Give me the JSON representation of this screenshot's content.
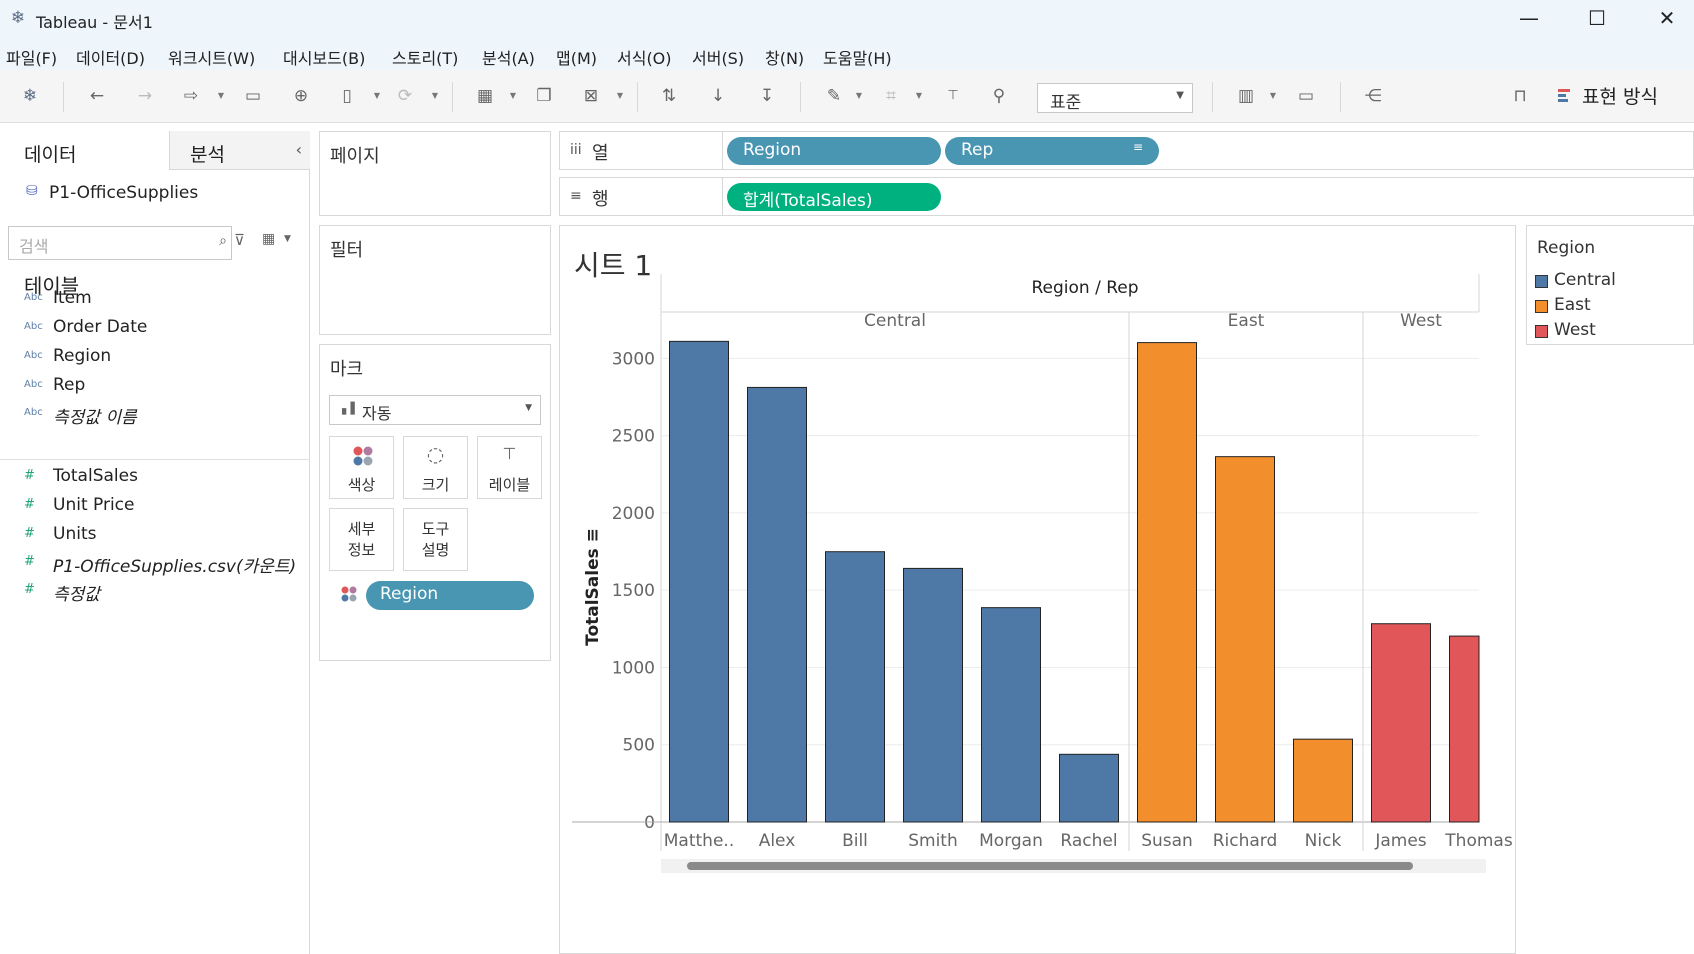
{
  "window": {
    "app_icon": "tableau-logo-icon",
    "title": "Tableau - 문서1",
    "minimize": "—",
    "maximize": "☐",
    "close": "✕"
  },
  "menu": [
    "파일(F)",
    "데이터(D)",
    "워크시트(W)",
    "대시보드(B)",
    "스토리(T)",
    "분석(A)",
    "맵(M)",
    "서식(O)",
    "서버(S)",
    "창(N)",
    "도움말(H)"
  ],
  "toolbar": {
    "fit_value": "표준",
    "show_me_label": "표현 방식",
    "icons": [
      "tableau-logo-icon",
      "undo-icon",
      "redo-icon",
      "replay-icon",
      "save-icon",
      "new-datasource-icon",
      "pause-updates-icon",
      "refresh-icon",
      "new-worksheet-icon",
      "duplicate-sheet-icon",
      "clear-sheet-icon",
      "swap-axes-icon",
      "sort-ascending-icon",
      "sort-descending-icon",
      "highlight-icon",
      "group-icon",
      "label-icon",
      "pin-icon",
      "cards-icon",
      "presentation-icon",
      "share-icon",
      "format-painter-icon",
      "show-me-icon"
    ]
  },
  "data_pane": {
    "tab_data": "데이터",
    "tab_analytics": "분석",
    "collapse_glyph": "‹",
    "datasource": "P1-OfficeSupplies",
    "search_placeholder": "검색",
    "tables_heading": "테이블",
    "dimension_icon": "Abc",
    "measure_icon": "#",
    "dimensions": [
      {
        "label": "Item",
        "italic": false
      },
      {
        "label": "Order Date",
        "italic": false
      },
      {
        "label": "Region",
        "italic": false
      },
      {
        "label": "Rep",
        "italic": false
      },
      {
        "label": "측정값 이름",
        "italic": true
      }
    ],
    "measures": [
      {
        "label": "TotalSales",
        "italic": false
      },
      {
        "label": "Unit Price",
        "italic": false
      },
      {
        "label": "Units",
        "italic": false
      },
      {
        "label": "P1-OfficeSupplies.csv(카운트)",
        "italic": true
      },
      {
        "label": "측정값",
        "italic": true
      }
    ]
  },
  "cards": {
    "pages": "페이지",
    "filters": "필터",
    "marks": "마크",
    "mark_type": "자동",
    "buttons": {
      "color": "색상",
      "size": "크기",
      "label": "레이블",
      "detail_1": "세부",
      "detail_2": "정보",
      "tooltip_1": "도구",
      "tooltip_2": "설명"
    },
    "marks_pill": "Region"
  },
  "shelves": {
    "columns_label": "열",
    "rows_label": "행",
    "columns_icon": "iii",
    "rows_icon": "≡",
    "columns_pills": [
      "Region",
      "Rep"
    ],
    "rows_pills": [
      "합계(TotalSales)"
    ]
  },
  "sheet_title": "시트 1",
  "legend": {
    "title": "Region",
    "items": [
      {
        "label": "Central",
        "color": "#4e79a7"
      },
      {
        "label": "East",
        "color": "#f28e2b"
      },
      {
        "label": "West",
        "color": "#e15759"
      }
    ]
  },
  "chart_data": {
    "type": "bar",
    "header_title": "Region / Rep",
    "ylabel": "TotalSales",
    "ylim": [
      0,
      3300
    ],
    "yticks": [
      0,
      500,
      1000,
      1500,
      2000,
      2500,
      3000
    ],
    "grid": true,
    "groups": [
      {
        "name": "Central",
        "color": "#4e79a7",
        "reps": [
          "Matthe..",
          "Alex",
          "Bill",
          "Smith",
          "Morgan",
          "Rachel"
        ],
        "values": [
          3110,
          2812,
          1749,
          1641,
          1387,
          438
        ]
      },
      {
        "name": "East",
        "color": "#f28e2b",
        "reps": [
          "Susan",
          "Richard",
          "Nick"
        ],
        "values": [
          3102,
          2364,
          536
        ]
      },
      {
        "name": "West",
        "color": "#e15759",
        "reps": [
          "James",
          "Thomas"
        ],
        "values": [
          1283,
          1203
        ]
      }
    ]
  }
}
